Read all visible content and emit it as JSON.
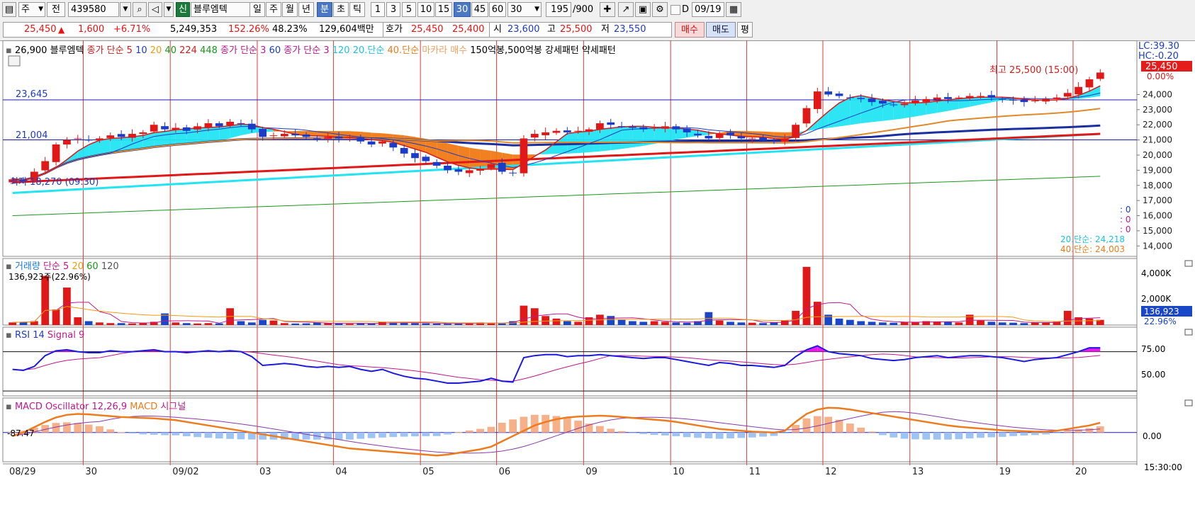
{
  "toolbar": {
    "period_btn": "주",
    "prev_btn": "전",
    "code_value": "439580",
    "stock_badge": "신",
    "stock_name": "블루엠텍",
    "period_tabs": [
      "일",
      "주",
      "월",
      "년",
      "분",
      "초",
      "틱"
    ],
    "selected_period": "분",
    "minute_tabs": [
      "1",
      "3",
      "5",
      "10",
      "15",
      "30",
      "45",
      "60"
    ],
    "selected_minute": "30",
    "minute_select": "30",
    "count_value": "195",
    "count_total": "/900",
    "d_label": "D",
    "date_value": "09/19"
  },
  "quote": {
    "price": "25,450",
    "change_arrow": "▲",
    "change": "1,600",
    "change_pct": "+6.71%",
    "volume": "5,249,353",
    "vol_ratio": "152.26%",
    "turnover": "48.23%",
    "amount": "129,604백만",
    "bid_label": "호가",
    "ask": "25,450",
    "bid": "25,400",
    "open_label": "시",
    "open": "23,600",
    "high_label": "고",
    "high": "25,500",
    "low_label": "저",
    "low": "23,550",
    "buy_btn": "매수",
    "sell_btn": "매도",
    "eval_btn": "평"
  },
  "legend_main": [
    {
      "text": "26,900",
      "color": "#000000"
    },
    {
      "text": "블루엠텍",
      "color": "#000000"
    },
    {
      "text": "종가 단순 5",
      "color": "#d81b1b"
    },
    {
      "text": "10",
      "color": "#1a3cc8"
    },
    {
      "text": "20",
      "color": "#f39c12"
    },
    {
      "text": "40",
      "color": "#1a9a1a"
    },
    {
      "text": "224",
      "color": "#d81b1b"
    },
    {
      "text": "448",
      "color": "#1a9a1a"
    },
    {
      "text": "종가 단순 3",
      "color": "#c0188c"
    },
    {
      "text": "60",
      "color": "#1a3cc8"
    },
    {
      "text": "종가 단순 3",
      "color": "#c0188c"
    },
    {
      "text": "120",
      "color": "#19c4e6"
    },
    {
      "text": "20.단순",
      "color": "#19c4e6"
    },
    {
      "text": "40.단순",
      "color": "#ee7b1d"
    },
    {
      "text": "마카라 매수",
      "color": "#f0a060"
    },
    {
      "text": "150억봉,500억봉 강세패턴",
      "color": "#000000"
    },
    {
      "text": "약세패턴",
      "color": "#000000"
    }
  ],
  "right_info": {
    "lc": "LC:39.30",
    "hc": "HC:-0.20",
    "price_tag": "25,450",
    "pct_tag": "0.00%",
    "ma20_label": "20.단순: 24,218",
    "ma40_label": "40.단순: 24,003",
    "zero1": ": 0",
    "zero2": ": 0",
    "zero3": ": 0"
  },
  "annotations": {
    "high_note": "최고 25,500 (15:00)",
    "low_note": "최저 18,270 (09:30)",
    "hline1": "23,645",
    "hline2": "21,004"
  },
  "volume_panel": {
    "legend": [
      {
        "text": "거래량",
        "color": "#1a7ad8"
      },
      {
        "text": "단순 5",
        "color": "#c0188c"
      },
      {
        "text": "20",
        "color": "#f39c12"
      },
      {
        "text": "60",
        "color": "#1a9a1a"
      },
      {
        "text": "120",
        "color": "#555555"
      }
    ],
    "subtitle": "136,923주(22.96%)",
    "ticks": [
      "4,000K",
      "2,000K"
    ],
    "value_tag": "136,923",
    "pct_tag": "22.96%"
  },
  "rsi_panel": {
    "legend": [
      {
        "text": "RSI 14",
        "color": "#1a3cc8"
      },
      {
        "text": "Signal 9",
        "color": "#c0188c"
      }
    ],
    "ticks": [
      "75.00",
      "50.00"
    ]
  },
  "macd_panel": {
    "legend": [
      {
        "text": "MACD Oscillator 12,26,9",
        "color": "#c0188c"
      },
      {
        "text": "MACD",
        "color": "#ee7b1d"
      },
      {
        "text": "시그널",
        "color": "#c0188c"
      }
    ],
    "left_value": "-87.47",
    "ticks": [
      "0.00"
    ]
  },
  "x_axis": {
    "labels": [
      "08/29",
      "30",
      "09/02",
      "03",
      "04",
      "05",
      "06",
      "09",
      "10",
      "11",
      "12",
      "13",
      "19",
      "20"
    ],
    "time_label": "15:30:00"
  },
  "chart_data": {
    "type": "candlestick",
    "symbol": "439580",
    "name": "블루엠텍",
    "interval": "30분",
    "ylim": [
      13500,
      27200
    ],
    "yticks": [
      14000,
      15000,
      16000,
      17000,
      18000,
      19000,
      20000,
      21000,
      22000,
      23000,
      24000,
      25000
    ],
    "ytick_labels": [
      "14,000",
      "15,000",
      "16,000",
      "17,000",
      "18,000",
      "19,000",
      "20,000",
      "21,000",
      "22,000",
      "23,000",
      "24,000"
    ],
    "day_labels": [
      "08/29",
      "30",
      "09/02",
      "03",
      "04",
      "05",
      "06",
      "09",
      "10",
      "11",
      "12",
      "13",
      "19",
      "20"
    ],
    "close": [
      18400,
      18300,
      18900,
      19600,
      20700,
      21000,
      21100,
      21000,
      21100,
      21300,
      21200,
      21400,
      21500,
      22000,
      21700,
      21800,
      21600,
      21900,
      22100,
      21900,
      22200,
      22100,
      21700,
      21200,
      21300,
      21400,
      21300,
      21200,
      21100,
      21200,
      21100,
      21200,
      20900,
      20700,
      20900,
      20500,
      20100,
      19800,
      19600,
      19300,
      19000,
      18900,
      19000,
      19100,
      19400,
      18900,
      18800,
      21100,
      21400,
      21500,
      21600,
      21500,
      21600,
      21700,
      22100,
      22000,
      21900,
      21800,
      21700,
      21800,
      21900,
      21700,
      21500,
      21300,
      21100,
      21400,
      21300,
      21100,
      21100,
      21000,
      20900,
      21100,
      22000,
      23100,
      24200,
      24000,
      23900,
      23800,
      23700,
      23500,
      23400,
      23300,
      23400,
      23600,
      23700,
      23800,
      23700,
      23800,
      23900,
      23900,
      23800,
      23700,
      23600,
      23500,
      23600,
      23700,
      23800,
      24100,
      24500,
      25000,
      25450
    ],
    "series": [
      {
        "name": "20.단순",
        "last": 24218
      },
      {
        "name": "40.단순",
        "last": 24003
      }
    ],
    "hlines": [
      23645,
      21004
    ],
    "rsi_ylim": [
      25,
      95
    ],
    "rsi": [
      52,
      51,
      55,
      66,
      71,
      72,
      70,
      69,
      69,
      71,
      70,
      70,
      71,
      72,
      70,
      70,
      69,
      70,
      71,
      70,
      71,
      70,
      65,
      56,
      57,
      58,
      57,
      55,
      54,
      55,
      54,
      55,
      52,
      50,
      52,
      48,
      45,
      43,
      42,
      40,
      38,
      38,
      39,
      40,
      43,
      40,
      39,
      64,
      66,
      67,
      67,
      65,
      66,
      66,
      67,
      66,
      65,
      64,
      63,
      64,
      64,
      62,
      60,
      58,
      56,
      59,
      58,
      56,
      56,
      55,
      54,
      56,
      65,
      72,
      76,
      70,
      68,
      67,
      66,
      63,
      62,
      61,
      62,
      64,
      65,
      66,
      64,
      65,
      66,
      66,
      65,
      64,
      62,
      60,
      62,
      63,
      64,
      67,
      70,
      74,
      74
    ],
    "macd_ylim": [
      -330,
      390
    ],
    "macd": [
      -40,
      0,
      60,
      120,
      170,
      200,
      210,
      205,
      195,
      185,
      175,
      170,
      165,
      160,
      150,
      140,
      120,
      100,
      80,
      60,
      40,
      20,
      0,
      -20,
      -40,
      -60,
      -80,
      -100,
      -120,
      -140,
      -160,
      -180,
      -190,
      -200,
      -210,
      -220,
      -230,
      -240,
      -250,
      -260,
      -250,
      -230,
      -210,
      -190,
      -160,
      -100,
      -40,
      20,
      80,
      120,
      150,
      170,
      180,
      185,
      190,
      185,
      175,
      165,
      155,
      145,
      135,
      120,
      100,
      80,
      60,
      40,
      30,
      20,
      10,
      5,
      0,
      20,
      120,
      210,
      260,
      280,
      275,
      260,
      240,
      220,
      200,
      180,
      160,
      140,
      120,
      100,
      80,
      65,
      55,
      45,
      35,
      25,
      20,
      15,
      10,
      10,
      20,
      40,
      60,
      80,
      110
    ],
    "volume_ylim": [
      0,
      4600
    ],
    "volume": [
      200,
      250,
      300,
      3800,
      1200,
      2900,
      600,
      300,
      200,
      150,
      150,
      120,
      180,
      250,
      900,
      200,
      150,
      120,
      150,
      130,
      1300,
      300,
      200,
      400,
      350,
      150,
      120,
      130,
      200,
      150,
      120,
      100,
      150,
      110,
      250,
      200,
      180,
      150,
      130,
      110,
      100,
      120,
      150,
      200,
      180,
      130,
      300,
      1500,
      1300,
      700,
      500,
      300,
      250,
      600,
      800,
      700,
      400,
      300,
      250,
      300,
      250,
      200,
      180,
      300,
      1000,
      350,
      250,
      200,
      180,
      150,
      200,
      350,
      1100,
      4500,
      1800,
      800,
      500,
      400,
      300,
      250,
      200,
      180,
      220,
      250,
      300,
      280,
      250,
      200,
      800,
      350,
      250,
      200,
      180,
      150,
      200,
      220,
      250,
      1100,
      600,
      500,
      400
    ]
  }
}
